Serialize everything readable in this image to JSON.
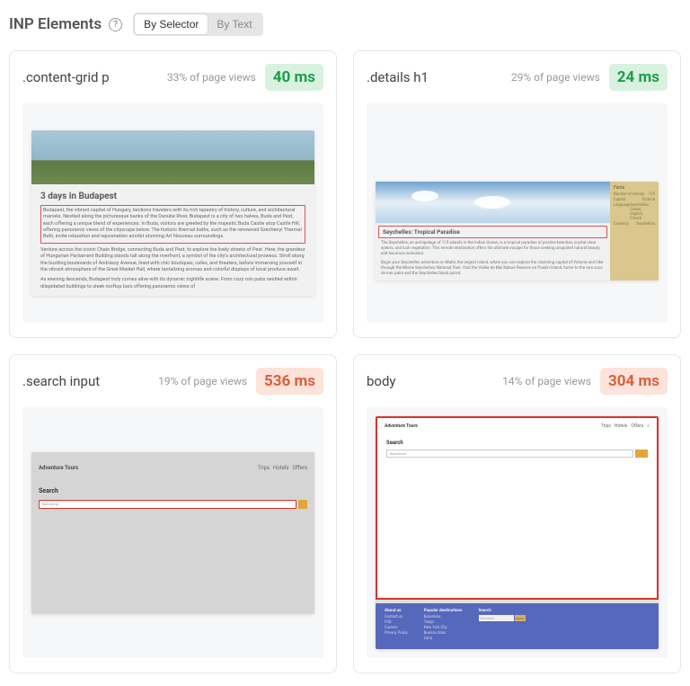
{
  "header": {
    "title": "INP Elements",
    "tab_selector": "By Selector",
    "tab_text": "By Text"
  },
  "cards": [
    {
      "selector": ".content-grid p",
      "page_views": "33% of page views",
      "metric": "40 ms",
      "metric_class": "good",
      "preview": {
        "type": "budapest",
        "title": "3 days in Budapest",
        "p1": "Budapest, the vibrant capital of Hungary, beckons travelers with its rich tapestry of history, culture, and architectural marvels. Nestled along the picturesque banks of the Danube River, Budapest is a city of two halves, Buda and Pest, each offering a unique blend of experiences. In Buda, visitors are greeted by the majestic Buda Castle atop Castle Hill, offering panoramic views of the cityscape below. The historic thermal baths, such as the renowned Széchenyi Thermal Bath, invite relaxation and rejuvenation amidst stunning Art Nouveau surroundings.",
        "p2": "Venture across the iconic Chain Bridge, connecting Buda and Pest, to explore the lively streets of Pest. Here, the grandeur of Hungarian Parliament Building stands tall along the riverfront, a symbol of the city's architectural prowess. Stroll along the bustling boulevards of Andrássy Avenue, lined with chic boutiques, cafes, and theaters, before immersing yourself in the vibrant atmosphere of the Great Market Hall, where tantalizing aromas and colorful displays of local produce await.",
        "p3": "As evening descends, Budapest truly comes alive with its dynamic nightlife scene. From cozy ruin pubs nestled within dilapidated buildings to sleek rooftop bars offering panoramic views of"
      }
    },
    {
      "selector": ".details h1",
      "page_views": "29% of page views",
      "metric": "24 ms",
      "metric_class": "good",
      "preview": {
        "type": "seychelles",
        "h1": "Seychelles: Tropical Paradise",
        "p1": "The Seychelles, an archipelago of 115 islands in the Indian Ocean, is a tropical paradise of pristine beaches, crystal-clear waters, and lush vegetation. This remote destination offers the ultimate escape for those seeking unspoiled natural beauty and luxurious seclusion.",
        "p2": "Begin your Seychelles adventure on Mahé, the largest island, where you can explore the charming capital of Victoria and hike through the Morne Seychellois National Park. Visit the Vallée de Mai Nature Reserve on Praslin Island, home to the rare coco de mer palm and the Seychelles black parrot.",
        "facts": {
          "title": "Facts",
          "rows": [
            [
              "Number of Islands",
              "115"
            ],
            [
              "Capital",
              "Victoria"
            ],
            [
              "Language",
              "Seychellois Creole, English, French"
            ],
            [
              "Currency",
              "Seychellois"
            ]
          ]
        }
      }
    },
    {
      "selector": ".search input",
      "page_views": "19% of page views",
      "metric": "536 ms",
      "metric_class": "bad",
      "preview": {
        "type": "search",
        "brand": "Adventure Tours",
        "nav": [
          "Trips",
          "Hotels",
          "Offers"
        ],
        "label": "Search",
        "placeholder": "Barcelona"
      }
    },
    {
      "selector": "body",
      "page_views": "14% of page views",
      "metric": "304 ms",
      "metric_class": "bad",
      "preview": {
        "type": "body",
        "brand": "Adventure Tours",
        "nav": [
          "Trips",
          "Hotels",
          "Offers"
        ],
        "search_label": "Search",
        "search_ph": "Barcelona",
        "search_btn": "Search",
        "footer": {
          "about": {
            "h": "About us",
            "links": [
              "Contact us",
              "FAQ",
              "Careers",
              "Privacy Policy"
            ]
          },
          "popular": {
            "h": "Popular destinations",
            "links": [
              "Barcelona",
              "Tokyo",
              "New York City",
              "Buenos Aires",
              "Lima"
            ]
          },
          "search": {
            "h": "Search",
            "ph": "Barcelona",
            "btn": "Search"
          }
        }
      }
    }
  ]
}
